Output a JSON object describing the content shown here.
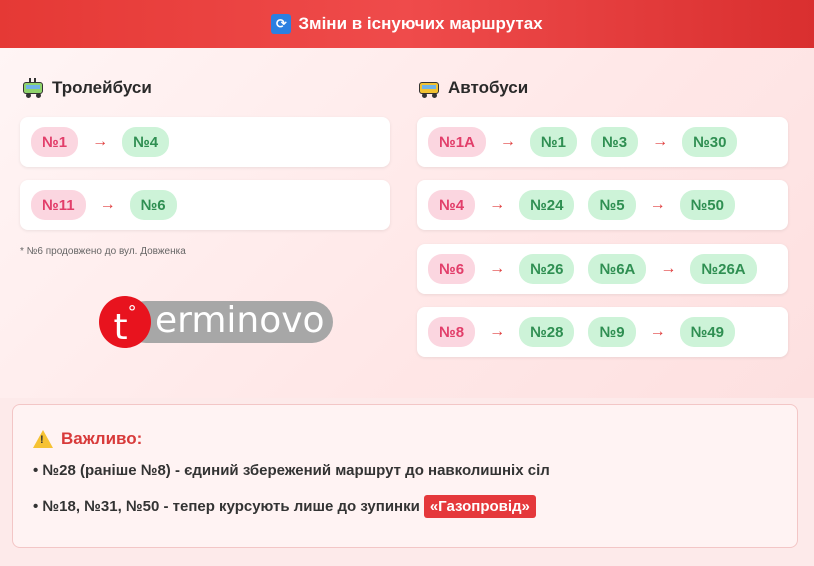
{
  "header": {
    "icon": "refresh-icon",
    "icon_glyph": "🔄",
    "title": "Зміни в існуючих маршрутах"
  },
  "trolleybus": {
    "title": "Тролейбуси",
    "rows": [
      {
        "from": "№1",
        "arrow": "→",
        "to": "№4"
      },
      {
        "from": "№11",
        "arrow": "→",
        "to": "№6"
      }
    ],
    "note": "* №6 продовжено до вул. Довженка"
  },
  "bus": {
    "title": "Автобуси",
    "rows": [
      {
        "from": "№1А",
        "arrow": "→",
        "to1": "№1",
        "to2": "№3",
        "arrow2": "→",
        "to3": "№30"
      },
      {
        "from": "№4",
        "arrow": "→",
        "to1": "№24",
        "to2": "№5",
        "arrow2": "→",
        "to3": "№50"
      },
      {
        "from": "№6",
        "arrow": "→",
        "to1": "№26",
        "to2": "№6А",
        "arrow2": "→",
        "to3": "№26А"
      },
      {
        "from": "№8",
        "arrow": "→",
        "to1": "№28",
        "to2": "№9",
        "arrow2": "→",
        "to3": "№49"
      }
    ]
  },
  "logo": {
    "letter": "t",
    "degree": "°",
    "word": "erminovo"
  },
  "alert": {
    "title": "Важливо:",
    "line1": "• №28 (раніше №8) - єдиний збережений маршрут до навколишніх сіл",
    "line2": "• №18, №31, №50 - тепер курсують лише до зупинки",
    "line2_highlight": "«Газопровід»"
  },
  "colors": {
    "header": "#e53935",
    "old_pill": "#fbd6e0",
    "new_pill": "#cdf3d8",
    "highlight": "#e5383b"
  }
}
